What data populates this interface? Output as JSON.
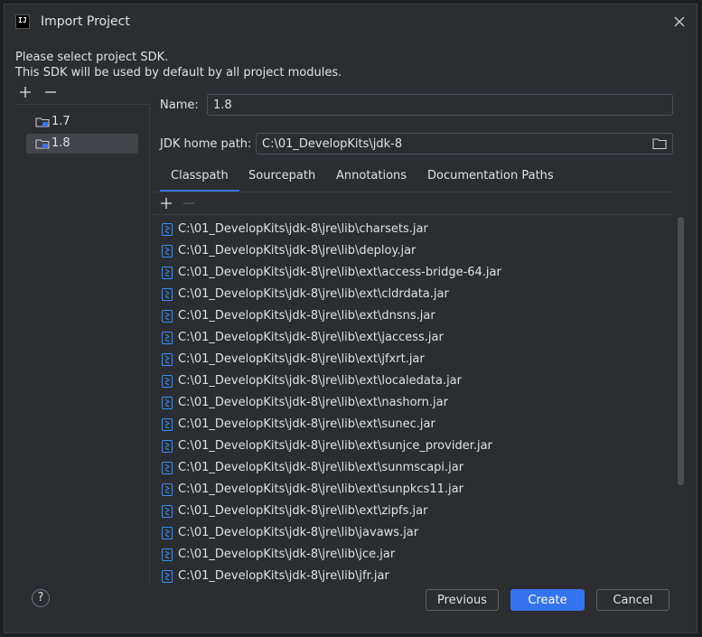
{
  "window": {
    "title": "Import Project",
    "logo_text": "IJ",
    "close_icon": "close-icon"
  },
  "intro": {
    "line1": "Please select project SDK.",
    "line2": "This SDK will be used by default by all project modules."
  },
  "sdk_list": {
    "toolbar": [
      "add-icon",
      "remove-icon"
    ],
    "items": [
      {
        "label": "1.7",
        "icon": "sdk-folder-icon",
        "selected": false
      },
      {
        "label": "1.8",
        "icon": "sdk-folder-icon",
        "selected": true
      }
    ]
  },
  "form": {
    "name_label": "Name:",
    "name_value": "1.8",
    "jdk_home_label": "JDK home path:",
    "jdk_home_value": "C:\\01_DevelopKits\\jdk-8"
  },
  "tabs": [
    {
      "label": "Classpath",
      "active": true
    },
    {
      "label": "Sourcepath",
      "active": false
    },
    {
      "label": "Annotations",
      "active": false
    },
    {
      "label": "Documentation Paths",
      "active": false
    }
  ],
  "classpath": {
    "toolbar": [
      "add-icon",
      "remove-icon"
    ],
    "entries": [
      "C:\\01_DevelopKits\\jdk-8\\jre\\lib\\charsets.jar",
      "C:\\01_DevelopKits\\jdk-8\\jre\\lib\\deploy.jar",
      "C:\\01_DevelopKits\\jdk-8\\jre\\lib\\ext\\access-bridge-64.jar",
      "C:\\01_DevelopKits\\jdk-8\\jre\\lib\\ext\\cldrdata.jar",
      "C:\\01_DevelopKits\\jdk-8\\jre\\lib\\ext\\dnsns.jar",
      "C:\\01_DevelopKits\\jdk-8\\jre\\lib\\ext\\jaccess.jar",
      "C:\\01_DevelopKits\\jdk-8\\jre\\lib\\ext\\jfxrt.jar",
      "C:\\01_DevelopKits\\jdk-8\\jre\\lib\\ext\\localedata.jar",
      "C:\\01_DevelopKits\\jdk-8\\jre\\lib\\ext\\nashorn.jar",
      "C:\\01_DevelopKits\\jdk-8\\jre\\lib\\ext\\sunec.jar",
      "C:\\01_DevelopKits\\jdk-8\\jre\\lib\\ext\\sunjce_provider.jar",
      "C:\\01_DevelopKits\\jdk-8\\jre\\lib\\ext\\sunmscapi.jar",
      "C:\\01_DevelopKits\\jdk-8\\jre\\lib\\ext\\sunpkcs11.jar",
      "C:\\01_DevelopKits\\jdk-8\\jre\\lib\\ext\\zipfs.jar",
      "C:\\01_DevelopKits\\jdk-8\\jre\\lib\\javaws.jar",
      "C:\\01_DevelopKits\\jdk-8\\jre\\lib\\jce.jar",
      "C:\\01_DevelopKits\\jdk-8\\jre\\lib\\jfr.jar"
    ]
  },
  "footer": {
    "help_label": "?",
    "previous_label": "Previous",
    "create_label": "Create",
    "cancel_label": "Cancel"
  },
  "colors": {
    "accent": "#3574f0",
    "background": "#2b2d30",
    "text": "#dfe1e5"
  }
}
